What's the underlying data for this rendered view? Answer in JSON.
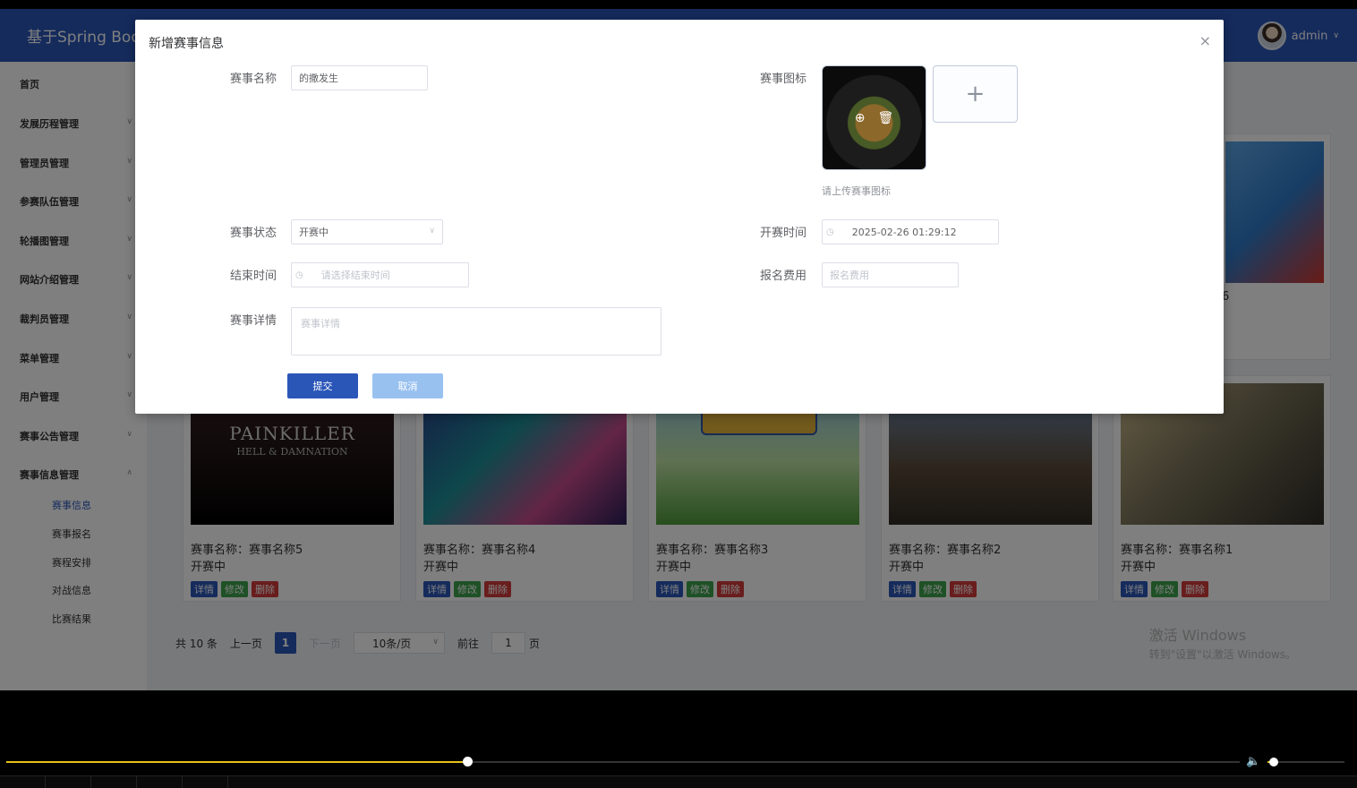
{
  "header": {
    "brand": "基于Spring Boo",
    "username": "admin"
  },
  "sidebar": {
    "items": [
      {
        "label": "首页"
      },
      {
        "label": "发展历程管理"
      },
      {
        "label": "管理员管理"
      },
      {
        "label": "参赛队伍管理"
      },
      {
        "label": "轮播图管理"
      },
      {
        "label": "网站介绍管理"
      },
      {
        "label": "裁判员管理"
      },
      {
        "label": "菜单管理"
      },
      {
        "label": "用户管理"
      },
      {
        "label": "赛事公告管理"
      },
      {
        "label": "赛事信息管理"
      }
    ],
    "subitems": [
      {
        "label": "赛事信息",
        "active": true
      },
      {
        "label": "赛事报名"
      },
      {
        "label": "赛程安排"
      },
      {
        "label": "对战信息"
      },
      {
        "label": "比赛结果"
      }
    ]
  },
  "cards": [
    {
      "name": "赛事名称：赛事名称5",
      "status": "开赛中",
      "thumb_title": "PAINKILLER",
      "thumb_sub": "HELL & DAMNATION"
    },
    {
      "name": "赛事名称：赛事名称4",
      "status": "开赛中"
    },
    {
      "name": "赛事名称：赛事名称3",
      "status": "开赛中"
    },
    {
      "name": "赛事名称：赛事名称2",
      "status": "开赛中"
    },
    {
      "name": "赛事名称：赛事名称1",
      "status": "开赛中"
    }
  ],
  "card_actions": {
    "detail": "详情",
    "edit": "修改",
    "delete": "删除"
  },
  "top_card_fragment": "6",
  "pagination": {
    "total": "共 10 条",
    "prev": "上一页",
    "current": "1",
    "next": "下一页",
    "page_size": "10条/页",
    "goto_label": "前往",
    "goto_value": "1",
    "page_unit": "页"
  },
  "watermark": {
    "line1": "激活 Windows",
    "line2": "转到\"设置\"以激活 Windows。"
  },
  "dialog": {
    "title": "新增赛事信息",
    "close": "×",
    "fields": {
      "name": {
        "label": "赛事名称",
        "value": "的撒发生"
      },
      "icon": {
        "label": "赛事图标",
        "hint": "请上传赛事图标"
      },
      "status": {
        "label": "赛事状态",
        "value": "开赛中"
      },
      "start_time": {
        "label": "开赛时间",
        "value": "2025-02-26 01:29:12"
      },
      "end_time": {
        "label": "结束时间",
        "placeholder": "请选择结束时间"
      },
      "fee": {
        "label": "报名费用",
        "placeholder": "报名费用"
      },
      "detail": {
        "label": "赛事详情",
        "placeholder": "赛事详情"
      }
    },
    "submit": "提交",
    "cancel": "取消"
  },
  "video": {
    "progress": 0.375,
    "volume": 0.08
  }
}
